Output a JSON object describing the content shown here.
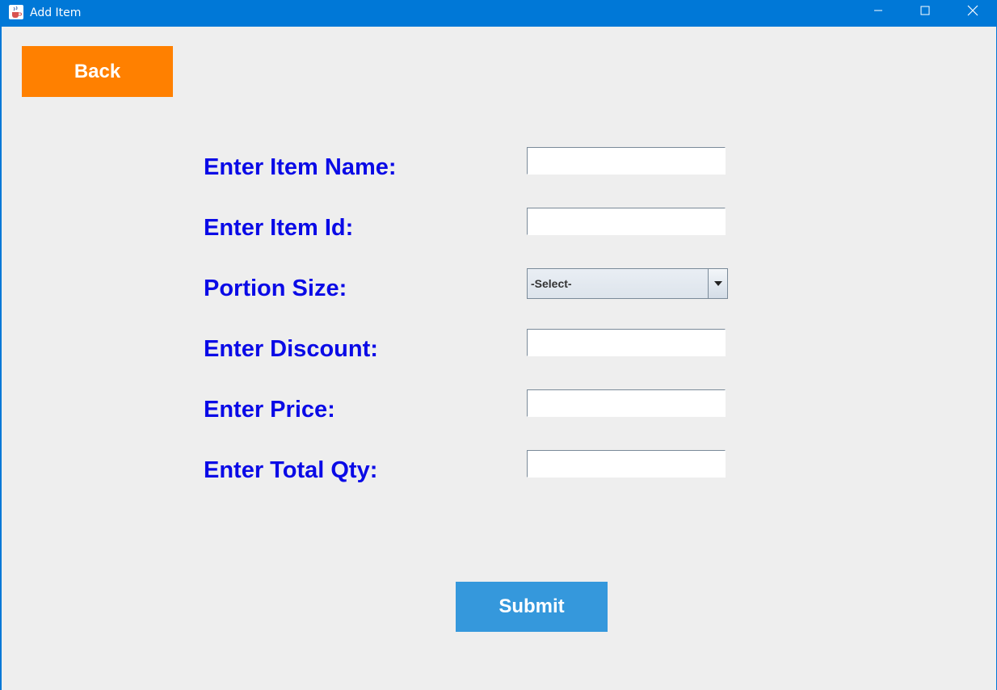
{
  "window": {
    "title": "Add Item",
    "accent_color": "#0078d7"
  },
  "buttons": {
    "back_label": "Back",
    "back_color": "#ff8000",
    "submit_label": "Submit",
    "submit_color": "#3598dc"
  },
  "form": {
    "label_color": "#0a0ae6",
    "item_name": {
      "label": "Enter Item Name:",
      "value": ""
    },
    "item_id": {
      "label": "Enter Item Id:",
      "value": ""
    },
    "portion_size": {
      "label": "Portion Size:",
      "selected": "-Select-"
    },
    "discount": {
      "label": "Enter Discount:",
      "value": ""
    },
    "price": {
      "label": "Enter Price:",
      "value": ""
    },
    "total_qty": {
      "label": "Enter Total Qty:",
      "value": ""
    }
  },
  "icons": {
    "app": "java-cup-icon",
    "minimize": "minimize-icon",
    "maximize": "maximize-icon",
    "close": "close-icon",
    "dropdown": "chevron-down-icon"
  }
}
